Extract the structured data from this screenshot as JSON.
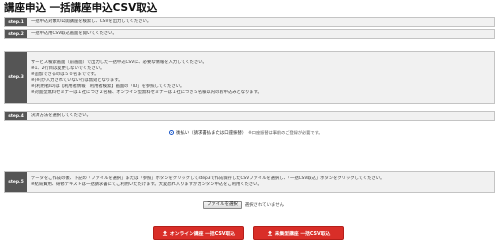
{
  "page": {
    "title": "講座申込 一括講座申込CSV取込"
  },
  "steps": {
    "step1": {
      "label": "step.1",
      "lines": [
        "一括申込対象の公開講座を検索し、CSVを出力してください。"
      ]
    },
    "step2": {
      "label": "step.2",
      "lines": [
        "一括申込用CSV取込画面を開いてください。"
      ]
    },
    "step3": {
      "label": "step.3",
      "lines": [
        "サービス検索画面（前画面）で出力した一括申込CSVに、必要な情報を入力してください。",
        "※1、2行目は変更しないでください。",
        "※追加できるのは５０名までです。",
        "※[※]が入力されていない行は無効となります。",
        "※[利用者ID]は【利用者情報　利用者検索】画面の「ID」を参照してください。",
        "※対面型無料セミナーは１社につき２名様、オンライン型無料セミナーは１社につき５名様以内のお申込みとなります。"
      ]
    },
    "step4": {
      "label": "step.4",
      "lines": [
        "決済方法を選択してください。"
      ]
    },
    "step5": {
      "label": "step.5",
      "lines": [
        "データをご作成の後、下記の「ファイルを選択」または「参照」ボタンをクリックしてstep3で作成保存したCSVファイルを選択し、「一括CSV取込」ボタンをクリックしてください。",
        "※結局費用、研修テキストは一括請求書にてご利用いただけます。大変恐れ入りますがカンタン申込をご利用ください。"
      ]
    }
  },
  "payment": {
    "option_label": "後払い（請求書払または口座振替）",
    "note": "※口座振替は事前のご登録が必要です。"
  },
  "file": {
    "button_label": "ファイルを選択",
    "status": "選択されていません"
  },
  "buttons": {
    "online": "オンライン講座 一括CSV取込",
    "physical": "未集型講座 一括CSV取込"
  },
  "colors": {
    "step_label_bg": "#555555",
    "row_bg": "#f1f1f1",
    "primary_button": "#d92e28",
    "radio": "#1a57c9"
  },
  "icons": {
    "upload": "upload-icon"
  }
}
